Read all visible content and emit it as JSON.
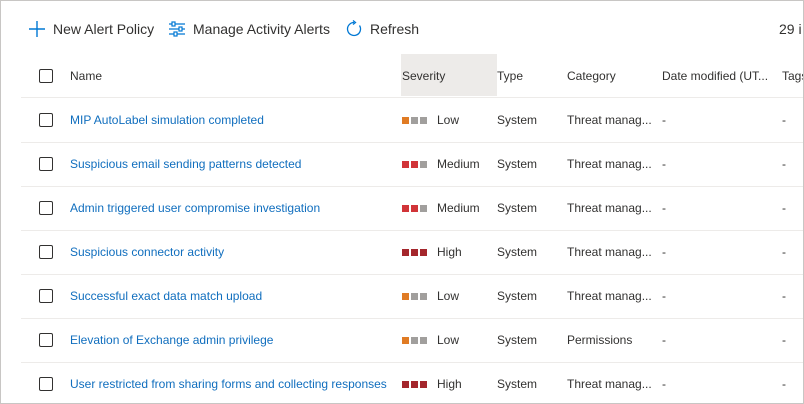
{
  "toolbar": {
    "new_policy": "New Alert Policy",
    "manage_alerts": "Manage Activity Alerts",
    "refresh": "Refresh",
    "count_text": "29 i"
  },
  "table": {
    "headers": {
      "name": "Name",
      "severity": "Severity",
      "type": "Type",
      "category": "Category",
      "date_modified": "Date modified (UT...",
      "tags": "Tags"
    },
    "severity_colors": {
      "Low": [
        "#e07b24",
        "#a19f9d",
        "#a19f9d"
      ],
      "Medium": [
        "#d13438",
        "#d13438",
        "#a19f9d"
      ],
      "High": [
        "#a4262c",
        "#a4262c",
        "#a4262c"
      ]
    },
    "rows": [
      {
        "name": "MIP AutoLabel simulation completed",
        "severity": "Low",
        "type": "System",
        "category": "Threat manag...",
        "date": "-",
        "tags": "-"
      },
      {
        "name": "Suspicious email sending patterns detected",
        "severity": "Medium",
        "type": "System",
        "category": "Threat manag...",
        "date": "-",
        "tags": "-"
      },
      {
        "name": "Admin triggered user compromise investigation",
        "severity": "Medium",
        "type": "System",
        "category": "Threat manag...",
        "date": "-",
        "tags": "-"
      },
      {
        "name": "Suspicious connector activity",
        "severity": "High",
        "type": "System",
        "category": "Threat manag...",
        "date": "-",
        "tags": "-"
      },
      {
        "name": "Successful exact data match upload",
        "severity": "Low",
        "type": "System",
        "category": "Threat manag...",
        "date": "-",
        "tags": "-"
      },
      {
        "name": "Elevation of Exchange admin privilege",
        "severity": "Low",
        "type": "System",
        "category": "Permissions",
        "date": "-",
        "tags": "-"
      },
      {
        "name": "User restricted from sharing forms and collecting responses",
        "severity": "High",
        "type": "System",
        "category": "Threat manag...",
        "date": "-",
        "tags": "-"
      }
    ]
  }
}
